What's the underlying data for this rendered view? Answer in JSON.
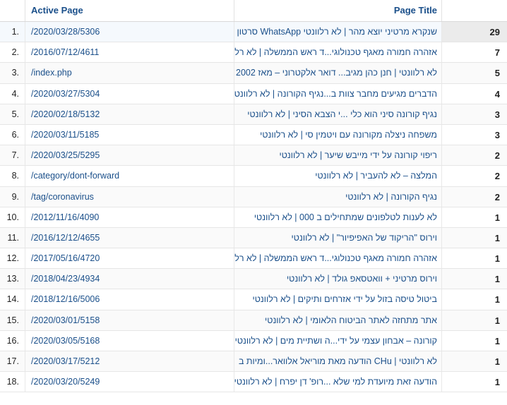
{
  "headers": {
    "path": "Active Page",
    "title": "Page Title"
  },
  "rows": [
    {
      "num": "1.",
      "path": "/2020/03/28/5306",
      "title": "שנקרא מרטיני יוצא מהר | לא רלוונטי WhatsApp סרטון",
      "value": "29"
    },
    {
      "num": "2.",
      "path": "/2016/07/12/4611",
      "title": "אזהרה חמורה מאגף טכנולוגי...ד ראש הממשלה | לא רלוונטי",
      "value": "7"
    },
    {
      "num": "3.",
      "path": "/index.php",
      "title": "לא רלוונטי | חנן כהן מגיב... דואר אלקטרוני – מאז 2002",
      "value": "5"
    },
    {
      "num": "4.",
      "path": "/2020/03/27/5304",
      "title": "הדברים מגיעים מחבר צוות ב...נגיף הקורונה | לא רלוונטי",
      "value": "4"
    },
    {
      "num": "5.",
      "path": "/2020/02/18/5132",
      "title": "נגיף קורונה סיני הוא כלי ...י הצבא הסיני | לא רלוונטי",
      "value": "3"
    },
    {
      "num": "6.",
      "path": "/2020/03/11/5185",
      "title": "משפחה ניצלה מקורונה עם ויטמין סי | לא רלוונטי",
      "value": "3"
    },
    {
      "num": "7.",
      "path": "/2020/03/25/5295",
      "title": "ריפוי קורונה על ידי מייבש שיער | לא רלוונטי",
      "value": "2"
    },
    {
      "num": "8.",
      "path": "/category/dont-forward",
      "title": "המלצה – לא להעביר | לא רלוונטי",
      "value": "2"
    },
    {
      "num": "9.",
      "path": "/tag/coronavirus",
      "title": "נגיף הקורונה | לא רלוונטי",
      "value": "2"
    },
    {
      "num": "10.",
      "path": "/2012/11/16/4090",
      "title": "לא לענות לטלפונים שמתחילים ב 000 | לא רלוונטי",
      "value": "1"
    },
    {
      "num": "11.",
      "path": "/2016/12/12/4655",
      "title": "וירוס \"הריקוד של האפיפיור\" | לא רלוונטי",
      "value": "1"
    },
    {
      "num": "12.",
      "path": "/2017/05/16/4720",
      "title": "אזהרה חמורה מאגף טכנולוגי...ד ראש הממשלה | לא רלוונטי",
      "value": "1"
    },
    {
      "num": "13.",
      "path": "/2018/04/23/4934",
      "title": "וירוס מרטיני + וואטסאפ גולד | לא רלוונטי",
      "value": "1"
    },
    {
      "num": "14.",
      "path": "/2018/12/16/5006",
      "title": "ביטול טיסה בזול על ידי אזרחים ותיקים | לא רלוונטי",
      "value": "1"
    },
    {
      "num": "15.",
      "path": "/2020/03/01/5158",
      "title": "אתר מתחזה לאתר הביטוח הלאומי | לא רלוונטי",
      "value": "1"
    },
    {
      "num": "16.",
      "path": "/2020/03/05/5168",
      "title": "קורונה – אבחון עצמי על ידי...ה ושתיית מים | לא רלוונטי",
      "value": "1"
    },
    {
      "num": "17.",
      "path": "/2020/03/17/5212",
      "title": "לא רלוונטי | CHu הודעה מאת מוריאל אלוואר...ומיות ב",
      "value": "1"
    },
    {
      "num": "18.",
      "path": "/2020/03/20/5249",
      "title": "הודעה זאת מיועדת למי שלא ...רופ' דן יפרח | לא רלוונטי",
      "value": "1"
    }
  ]
}
